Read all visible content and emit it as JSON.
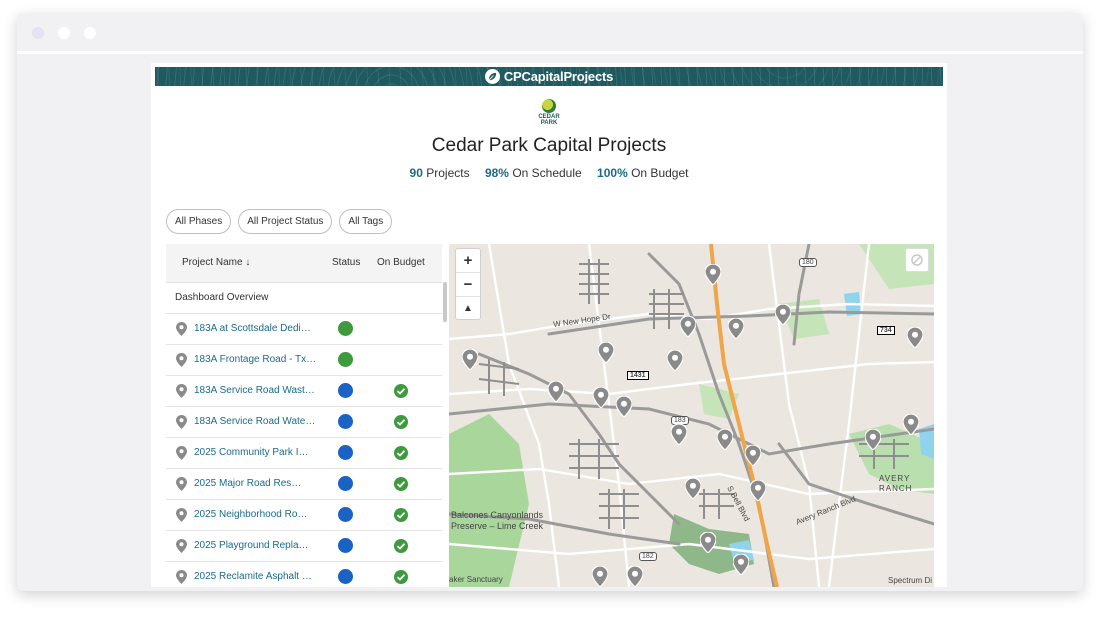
{
  "banner": {
    "title": "CPCapitalProjects"
  },
  "logo": {
    "line1": "CEDAR",
    "line2": "PARK"
  },
  "page": {
    "title": "Cedar Park Capital Projects"
  },
  "stats": [
    {
      "value": "90",
      "label": "Projects"
    },
    {
      "value": "98%",
      "label": "On Schedule"
    },
    {
      "value": "100%",
      "label": "On Budget"
    }
  ],
  "filters": [
    "All Phases",
    "All Project Status",
    "All Tags"
  ],
  "table": {
    "headers": {
      "name": "Project Name ↓",
      "status": "Status",
      "budget": "On Budget"
    },
    "overview": "Dashboard Overview",
    "rows": [
      {
        "name": "183A at Scottsdale Dedi…",
        "status_color": "#3d9a3d",
        "on_budget": false
      },
      {
        "name": "183A Frontage Road - Tx…",
        "status_color": "#3d9a3d",
        "on_budget": false
      },
      {
        "name": "183A Service Road Wast…",
        "status_color": "#1a63c4",
        "on_budget": true
      },
      {
        "name": "183A Service Road Wate…",
        "status_color": "#1a63c4",
        "on_budget": true
      },
      {
        "name": "2025 Community Park I…",
        "status_color": "#1a63c4",
        "on_budget": true
      },
      {
        "name": "2025 Major Road Res…",
        "status_color": "#1a63c4",
        "on_budget": true
      },
      {
        "name": "2025 Neighborhood Ro…",
        "status_color": "#1a63c4",
        "on_budget": true
      },
      {
        "name": "2025 Playground Repla…",
        "status_color": "#1a63c4",
        "on_budget": true
      },
      {
        "name": "2025 Reclamite Asphalt …",
        "status_color": "#1a63c4",
        "on_budget": true
      }
    ]
  },
  "map": {
    "zoom_in": "+",
    "zoom_out": "−",
    "compass": "▲",
    "labels": {
      "new_hope": "W New Hope Dr",
      "bell": "S Bell Blvd",
      "avery_blvd": "Avery Ranch Blvd",
      "avery_ranch_1": "AVERY",
      "avery_ranch_2": "RANCH",
      "balcones_1": "Balcones Canyonlands",
      "balcones_2": "Preserve – Lime Creek",
      "sanctuary": "aker Sanctuary",
      "shield_183": "183",
      "shield_182": "182",
      "shield_180": "180",
      "shield_1431": "1431",
      "shield_734": "734"
    },
    "attribution": "Spectrum Di",
    "colors": {
      "marker": "#8a8a8a",
      "highway": "#f0a54a",
      "park": "#a9d79b",
      "water": "#8fd3ec"
    }
  }
}
